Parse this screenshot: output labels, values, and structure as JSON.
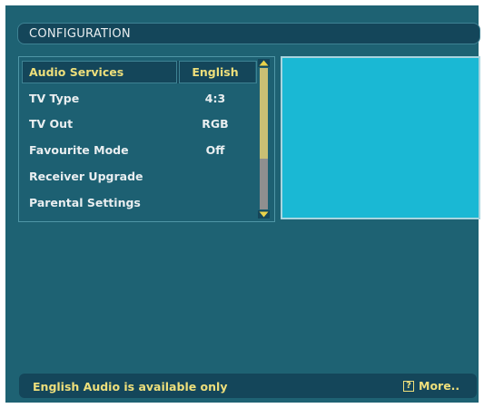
{
  "header": {
    "title": "CONFIGURATION"
  },
  "menu": {
    "items": [
      {
        "label": "Audio Services",
        "value": "English",
        "selected": true
      },
      {
        "label": "TV Type",
        "value": "4:3"
      },
      {
        "label": "TV Out",
        "value": "RGB"
      },
      {
        "label": "Favourite Mode",
        "value": "Off"
      },
      {
        "label": "Receiver Upgrade",
        "value": ""
      },
      {
        "label": "Parental Settings",
        "value": ""
      }
    ]
  },
  "status": {
    "message": "English Audio is available only",
    "help_glyph": "?",
    "more_label": "More.."
  },
  "colors": {
    "background": "#1e6273",
    "bar": "#14465a",
    "highlight_text": "#eedf7b",
    "preview": "#1ab8d4"
  }
}
